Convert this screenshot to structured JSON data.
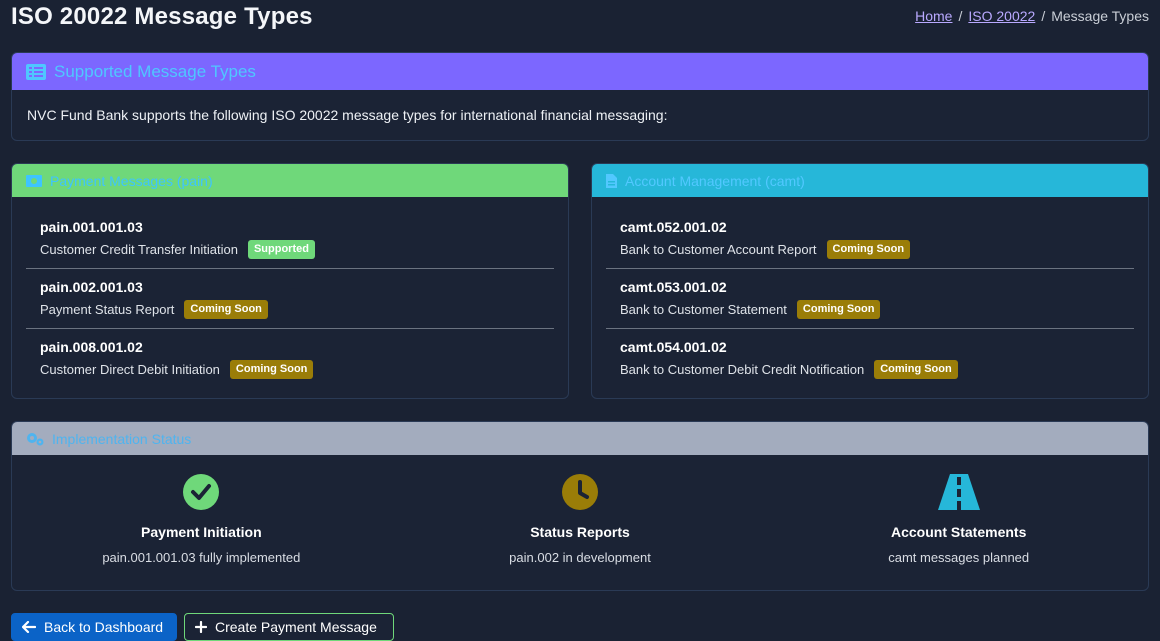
{
  "page": {
    "title": "ISO 20022 Message Types",
    "breadcrumb": [
      {
        "label": "Home",
        "link": true
      },
      {
        "label": "ISO 20022",
        "link": true
      },
      {
        "label": "Message Types",
        "link": false
      }
    ]
  },
  "supported_card": {
    "header": "Supported Message Types",
    "icon": "list-icon",
    "description": "NVC Fund Bank supports the following ISO 20022 message types for international financial messaging:"
  },
  "payment_card": {
    "header": "Payment Messages (pain)",
    "icon": "money-bill-icon",
    "items": [
      {
        "code": "pain.001.001.03",
        "name": "Customer Credit Transfer Initiation",
        "badge": "Supported",
        "status": "supported"
      },
      {
        "code": "pain.002.001.03",
        "name": "Payment Status Report",
        "badge": "Coming Soon",
        "status": "soon"
      },
      {
        "code": "pain.008.001.02",
        "name": "Customer Direct Debit Initiation",
        "badge": "Coming Soon",
        "status": "soon"
      }
    ]
  },
  "account_card": {
    "header": "Account Management (camt)",
    "icon": "file-icon",
    "items": [
      {
        "code": "camt.052.001.02",
        "name": "Bank to Customer Account Report",
        "badge": "Coming Soon",
        "status": "soon"
      },
      {
        "code": "camt.053.001.02",
        "name": "Bank to Customer Statement",
        "badge": "Coming Soon",
        "status": "soon"
      },
      {
        "code": "camt.054.001.02",
        "name": "Bank to Customer Debit Credit Notification",
        "badge": "Coming Soon",
        "status": "soon"
      }
    ]
  },
  "implementation_card": {
    "header": "Implementation Status",
    "icon": "cogs-icon",
    "columns": [
      {
        "title": "Payment Initiation",
        "subtitle": "pain.001.001.03 fully implemented",
        "icon": "check-circle-icon",
        "color": "#6fd87a"
      },
      {
        "title": "Status Reports",
        "subtitle": "pain.002 in development",
        "icon": "clock-icon",
        "color": "#9a7d08"
      },
      {
        "title": "Account Statements",
        "subtitle": "camt messages planned",
        "icon": "road-icon",
        "color": "#26b7d9"
      }
    ]
  },
  "buttons": {
    "back": "Back to Dashboard",
    "create": "Create Payment Message"
  },
  "colors": {
    "background": "#1a2233",
    "purple_header": "#7c67ff",
    "green_header": "#6fd87a",
    "cyan_header": "#26b7d9",
    "gray_header": "#a3acbe",
    "primary_button": "#0b63c7",
    "warning_badge": "#9a7d08"
  }
}
